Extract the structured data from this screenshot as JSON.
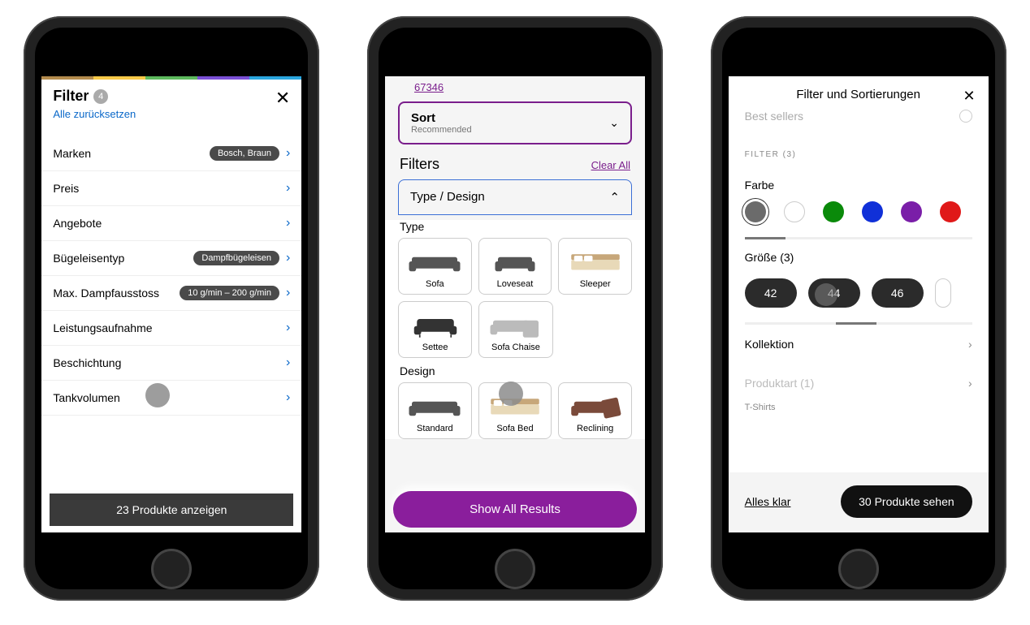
{
  "phone1": {
    "title": "Filter",
    "count": "4",
    "reset": "Alle zurücksetzen",
    "rows": [
      {
        "label": "Marken",
        "pill": "Bosch, Braun"
      },
      {
        "label": "Preis",
        "pill": ""
      },
      {
        "label": "Angebote",
        "pill": ""
      },
      {
        "label": "Bügeleisentyp",
        "pill": "Dampfbügeleisen"
      },
      {
        "label": "Max. Dampfausstoss",
        "pill": "10 g/min – 200 g/min"
      },
      {
        "label": "Leistungsaufnahme",
        "pill": ""
      },
      {
        "label": "Beschichtung",
        "pill": ""
      },
      {
        "label": "Tankvolumen",
        "pill": ""
      }
    ],
    "cta": "23 Produkte anzeigen",
    "rainbow": [
      "#b38b4d",
      "#f7c948",
      "#5cb85c",
      "#7a4fd6",
      "#2aa6de"
    ]
  },
  "phone2": {
    "top_link": "67346",
    "sort_label": "Sort",
    "sort_value": "Recommended",
    "filters_label": "Filters",
    "clear_all": "Clear All",
    "panel_title": "Type / Design",
    "type_label": "Type",
    "design_label": "Design",
    "type_tiles": [
      "Sofa",
      "Loveseat",
      "Sleeper",
      "Settee",
      "Sofa Chaise"
    ],
    "design_tiles": [
      "Standard",
      "Sofa Bed",
      "Reclining"
    ],
    "cta": "Show All Results"
  },
  "phone3": {
    "title": "Filter und Sortierungen",
    "best_sellers": "Best sellers",
    "filter_header": "FILTER (3)",
    "color_label": "Farbe",
    "colors": [
      "#6b6b6b",
      "#ffffff",
      "#0a8a0a",
      "#1030d8",
      "#7a1ea8",
      "#e01919"
    ],
    "size_label": "Größe (3)",
    "sizes": [
      "42",
      "44",
      "46"
    ],
    "kollektion": "Kollektion",
    "produktart": "Produktart (1)",
    "produktart_sub": "T-Shirts",
    "clear": "Alles klar",
    "cta": "30 Produkte sehen"
  }
}
